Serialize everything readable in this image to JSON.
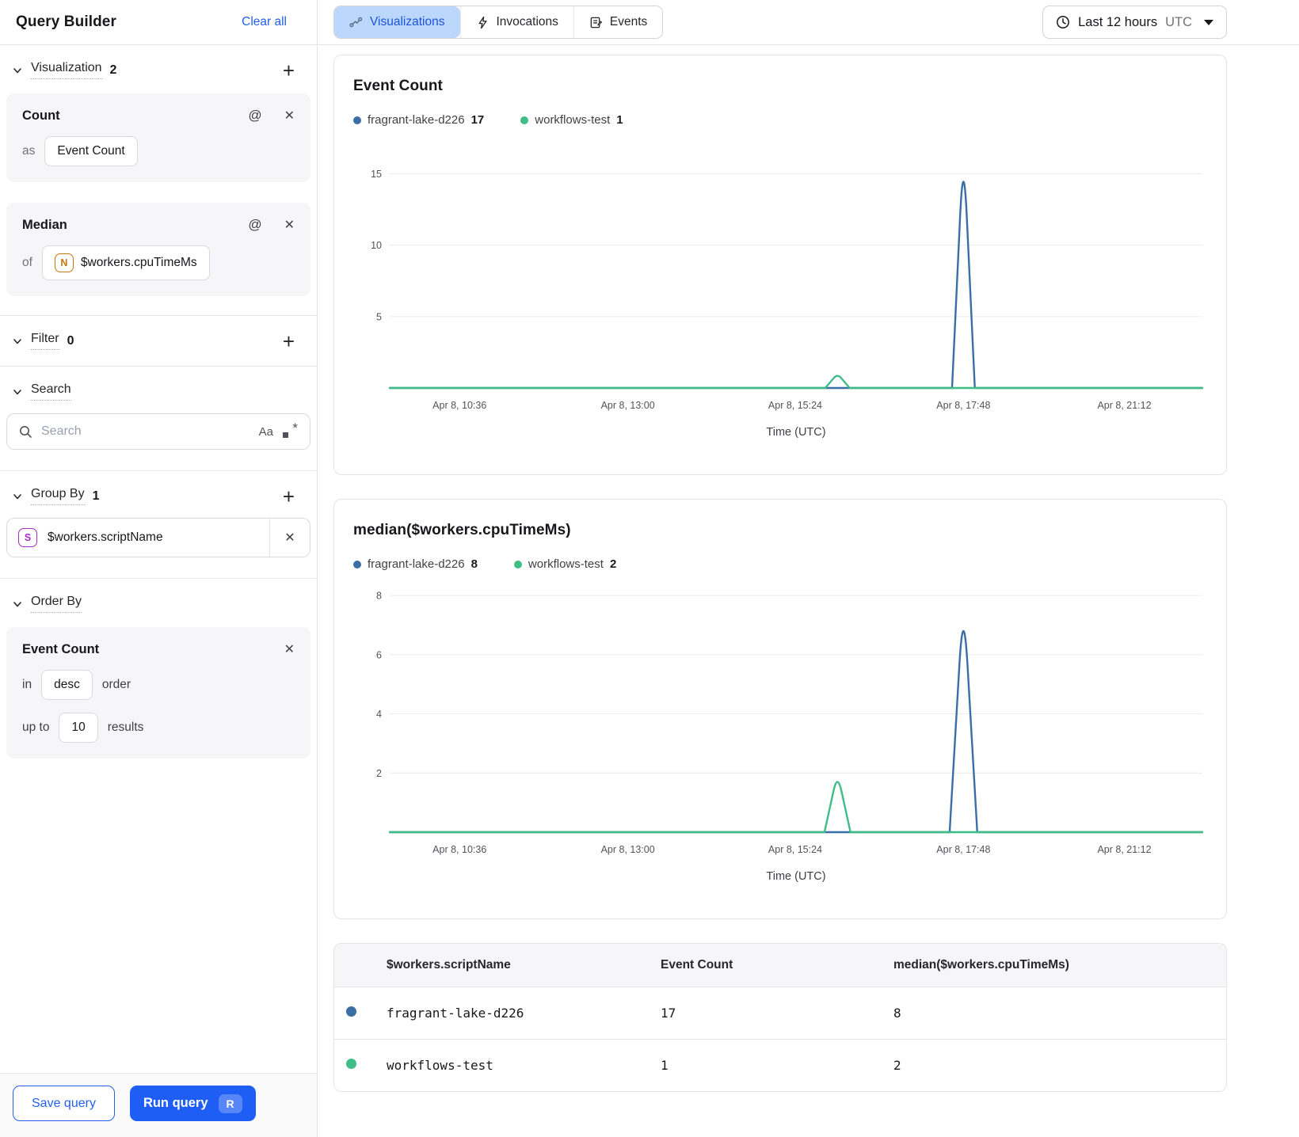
{
  "sidebar": {
    "title": "Query Builder",
    "clear_all": "Clear all",
    "visualization": {
      "label": "Visualization",
      "count": "2",
      "count_card": {
        "title": "Count",
        "as_label": "as",
        "value": "Event Count"
      },
      "median_card": {
        "title": "Median",
        "of_label": "of",
        "field_type_letter": "N",
        "value": "$workers.cpuTimeMs"
      }
    },
    "filter": {
      "label": "Filter",
      "count": "0"
    },
    "search": {
      "label": "Search",
      "placeholder": "Search",
      "case_toggle": "Aa",
      "regex_asterisk": "*"
    },
    "group_by": {
      "label": "Group By",
      "count": "1",
      "field_type_letter": "S",
      "value": "$workers.scriptName"
    },
    "order_by": {
      "label": "Order By",
      "field": "Event Count",
      "in_label": "in",
      "direction": "desc",
      "order_label": "order",
      "up_to_label": "up to",
      "limit": "10",
      "results_label": "results"
    },
    "footer": {
      "save_label": "Save query",
      "run_label": "Run query",
      "run_shortcut": "R"
    }
  },
  "topbar": {
    "tabs": [
      {
        "label": "Visualizations",
        "active": true
      },
      {
        "label": "Invocations",
        "active": false
      },
      {
        "label": "Events",
        "active": false
      }
    ],
    "time_range": {
      "label": "Last 12 hours",
      "timezone": "UTC"
    }
  },
  "chart_data": [
    {
      "type": "line",
      "title": "Event Count",
      "xlabel": "Time (UTC)",
      "ylim": [
        0,
        17.3
      ],
      "yticks": [
        5,
        10,
        15
      ],
      "xticks": [
        "Apr 8, 10:36",
        "Apr 8, 13:00",
        "Apr 8, 15:24",
        "Apr 8, 17:48",
        "Apr 8, 21:12"
      ],
      "xtick_fracs": [
        0.086,
        0.293,
        0.499,
        0.706,
        0.904
      ],
      "grid": true,
      "legend_position": "top",
      "legend": [
        {
          "name": "fragrant-lake-d226",
          "value": "17",
          "color": "#3b6ea5"
        },
        {
          "name": "workflows-test",
          "value": "1",
          "color": "#3fbd86"
        }
      ],
      "series": [
        {
          "name": "fragrant-lake-d226",
          "color": "#3b6ea5",
          "points": [
            [
              0,
              0
            ],
            [
              0.692,
              0
            ],
            [
              0.706,
              17
            ],
            [
              0.72,
              0
            ],
            [
              1,
              0
            ]
          ]
        },
        {
          "name": "workflows-test",
          "color": "#3fbd86",
          "points": [
            [
              0,
              0
            ],
            [
              0.536,
              0
            ],
            [
              0.551,
              1
            ],
            [
              0.566,
              0
            ],
            [
              1,
              0
            ]
          ]
        }
      ]
    },
    {
      "type": "line",
      "title": "median($workers.cpuTimeMs)",
      "xlabel": "Time (UTC)",
      "ylim": [
        0,
        8.35
      ],
      "yticks": [
        2,
        4,
        6,
        8
      ],
      "xticks": [
        "Apr 8, 10:36",
        "Apr 8, 13:00",
        "Apr 8, 15:24",
        "Apr 8, 17:48",
        "Apr 8, 21:12"
      ],
      "xtick_fracs": [
        0.086,
        0.293,
        0.499,
        0.706,
        0.904
      ],
      "grid": true,
      "legend_position": "top",
      "legend": [
        {
          "name": "fragrant-lake-d226",
          "value": "8",
          "color": "#3b6ea5"
        },
        {
          "name": "workflows-test",
          "value": "2",
          "color": "#3fbd86"
        }
      ],
      "series": [
        {
          "name": "fragrant-lake-d226",
          "color": "#3b6ea5",
          "points": [
            [
              0,
              0
            ],
            [
              0.689,
              0
            ],
            [
              0.706,
              8
            ],
            [
              0.723,
              0
            ],
            [
              1,
              0
            ]
          ]
        },
        {
          "name": "workflows-test",
          "color": "#3fbd86",
          "points": [
            [
              0,
              0
            ],
            [
              0.535,
              0
            ],
            [
              0.551,
              2
            ],
            [
              0.567,
              0
            ],
            [
              1,
              0
            ]
          ]
        }
      ]
    }
  ],
  "table": {
    "columns": [
      "$workers.scriptName",
      "Event Count",
      "median($workers.cpuTimeMs)"
    ],
    "rows": [
      {
        "color": "#3b6ea5",
        "name": "fragrant-lake-d226",
        "event_count": "17",
        "median": "8"
      },
      {
        "color": "#3fbd86",
        "name": "workflows-test",
        "event_count": "1",
        "median": "2"
      }
    ]
  },
  "colors": {
    "accent": "#1e5ef5",
    "series_blue": "#3b6ea5",
    "series_green": "#3fbd86",
    "tab_selected_bg": "#bcd7fc",
    "tab_selected_text": "#1c53da"
  }
}
